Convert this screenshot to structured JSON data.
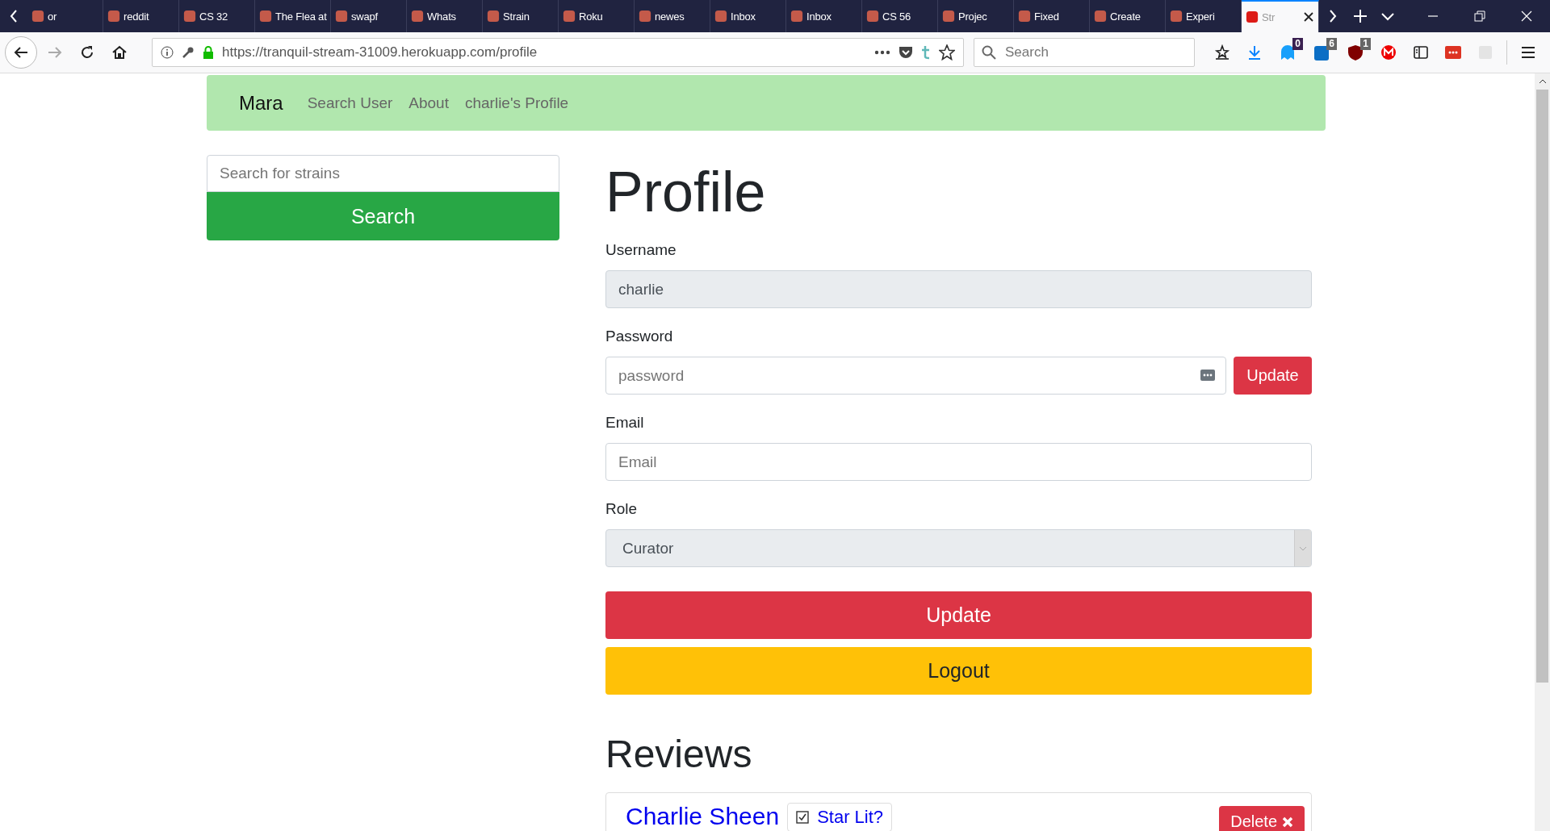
{
  "browser": {
    "tabs": [
      {
        "title": "or",
        "selected": false
      },
      {
        "title": "reddit",
        "selected": false
      },
      {
        "title": "CS 32",
        "selected": false
      },
      {
        "title": "The Flea at",
        "selected": false
      },
      {
        "title": "swapf",
        "selected": false
      },
      {
        "title": "Whats",
        "selected": false
      },
      {
        "title": "Strain",
        "selected": false
      },
      {
        "title": "Roku",
        "selected": false
      },
      {
        "title": "newes",
        "selected": false
      },
      {
        "title": "Inbox",
        "selected": false
      },
      {
        "title": "Inbox",
        "selected": false
      },
      {
        "title": "CS 56",
        "selected": false
      },
      {
        "title": "Projec",
        "selected": false
      },
      {
        "title": "Fixed",
        "selected": false
      },
      {
        "title": "Create",
        "selected": false
      },
      {
        "title": "Experi",
        "selected": false
      },
      {
        "title": "Str",
        "selected": true
      }
    ],
    "url": "https://tranquil-stream-31009.herokuapp.com/profile",
    "search": {
      "placeholder": "Search"
    },
    "badges": [
      {
        "count": "0"
      },
      {
        "count": "6"
      },
      {
        "count": "1"
      }
    ]
  },
  "navbar": {
    "brand": "Mara",
    "links": [
      "Search User",
      "About",
      "charlie's Profile"
    ]
  },
  "sidebar": {
    "search": {
      "placeholder": "Search for strains"
    },
    "button": "Search"
  },
  "profile": {
    "title": "Profile",
    "fields": [
      {
        "kind": "text",
        "label": "Username",
        "value": "charlie",
        "disabled": true
      },
      {
        "kind": "password",
        "label": "Password",
        "placeholder": "password",
        "button": "Update"
      },
      {
        "kind": "text",
        "label": "Email",
        "placeholder": "Email",
        "disabled": false
      },
      {
        "kind": "select",
        "label": "Role",
        "value": "Curator",
        "disabled": true
      }
    ],
    "update_button": "Update",
    "logout_button": "Logout"
  },
  "reviews": {
    "title": "Reviews",
    "items": [
      {
        "strain": "Charlie Sheen",
        "star_lit": {
          "label": "Star Lit?",
          "checked": true
        },
        "delete_button": "Delete"
      }
    ]
  }
}
